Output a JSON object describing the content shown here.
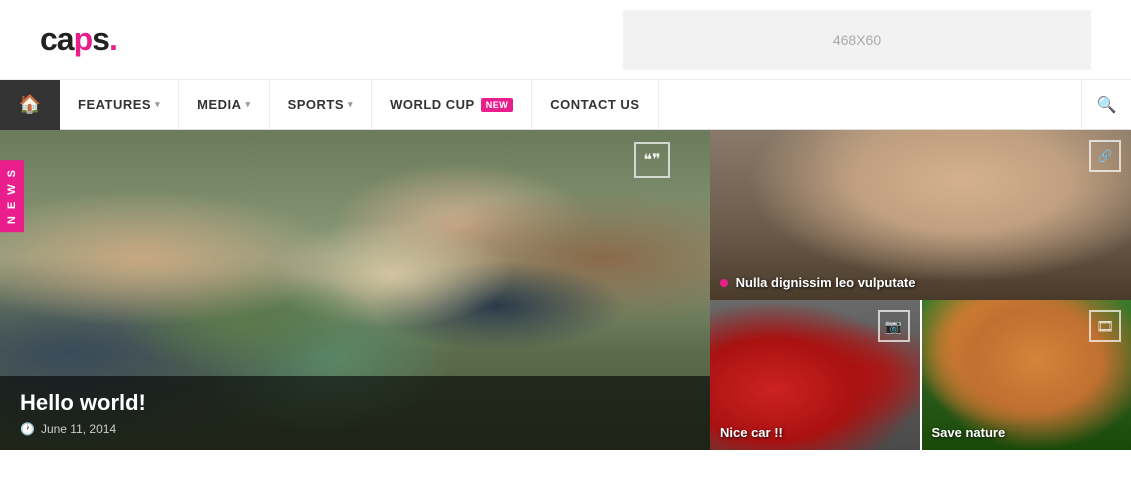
{
  "header": {
    "logo": {
      "ca": "ca",
      "p": "p",
      "s": "s.",
      "ariaLabel": "CAPS logo"
    },
    "adBanner": {
      "label": "468X60"
    }
  },
  "nav": {
    "home": "⌂",
    "items": [
      {
        "label": "FEATURES",
        "hasDropdown": true
      },
      {
        "label": "MEDIA",
        "hasDropdown": true
      },
      {
        "label": "SPORTS",
        "hasDropdown": true
      },
      {
        "label": "WORLD CUP",
        "hasDropdown": false,
        "badge": "NEW"
      },
      {
        "label": "CONTACT US",
        "hasDropdown": false
      }
    ],
    "searchIcon": "🔍"
  },
  "featured": {
    "newsTag": "N E W S",
    "quoteIcon": "❝",
    "title": "Hello world!",
    "date": "June 11, 2014"
  },
  "sidebar": {
    "top": {
      "caption": "Nulla dignissim leo vulputate",
      "linkIcon": "🔗"
    },
    "bottomLeft": {
      "caption": "Nice car !!",
      "camIcon": "📷"
    },
    "bottomRight": {
      "caption": "Save nature",
      "filmIcon": "🎞"
    }
  }
}
